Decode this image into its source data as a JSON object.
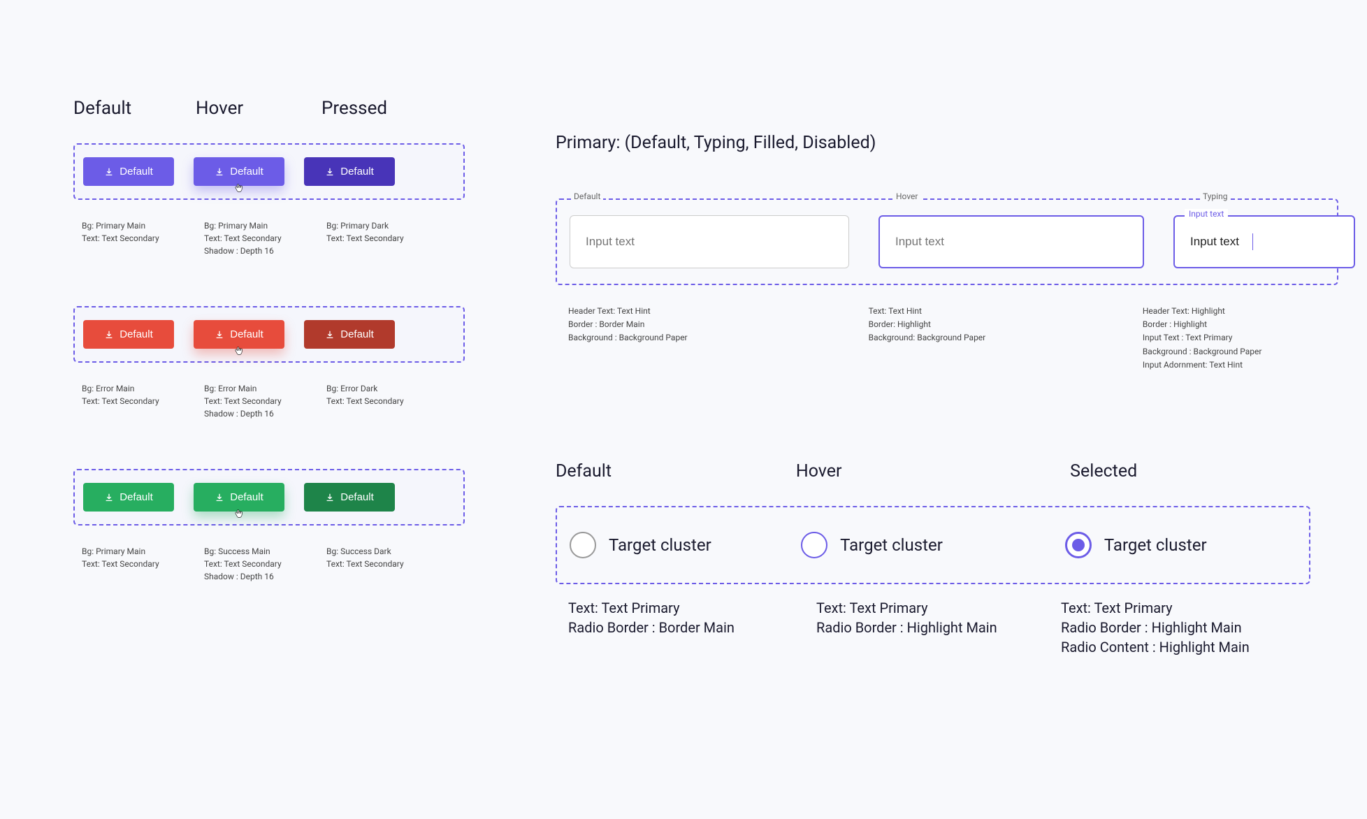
{
  "button_states": {
    "default": "Default",
    "hover": "Hover",
    "pressed": "Pressed"
  },
  "button_label": "Default",
  "button_specs": {
    "primary": {
      "default": "Bg: Primary Main\nText: Text Secondary",
      "hover": "Bg: Primary Main\nText: Text Secondary\nShadow : Depth 16",
      "pressed": "Bg: Primary Dark\nText: Text Secondary"
    },
    "error": {
      "default": "Bg: Error Main\nText: Text Secondary",
      "hover": "Bg: Error Main\nText: Text Secondary\nShadow : Depth 16",
      "pressed": "Bg: Error Dark\nText: Text Secondary"
    },
    "success": {
      "default": "Bg: Primary Main\nText: Text Secondary",
      "hover": "Bg: Success Main\nText: Text Secondary\nShadow : Depth 16",
      "pressed": "Bg: Success Dark\nText: Text Secondary"
    }
  },
  "input_section_title": "Primary: (Default, Typing, Filled, Disabled)",
  "input_states": {
    "default": "Default",
    "hover": "Hover",
    "typing": "Typing"
  },
  "input_placeholder": "Input text",
  "input_value_typing": "Input text",
  "input_floating_label": "Input text",
  "input_specs": {
    "default": "Header Text: Text Hint\nBorder : Border  Main\nBackground : Background Paper",
    "hover": "Text: Text Hint\nBorder:  Highlight\nBackground: Background Paper",
    "typing": "Header Text: Highlight\nBorder : Highlight\nInput Text : Text Primary\nBackground : Background Paper\nInput Adornment: Text Hint"
  },
  "radio_states": {
    "default": "Default",
    "hover": "Hover",
    "selected": "Selected"
  },
  "radio_label": "Target cluster",
  "radio_specs": {
    "default": "Text: Text Primary\nRadio Border : Border Main",
    "hover": "Text: Text Primary\nRadio Border : Highlight Main",
    "selected": "Text: Text Primary\nRadio Border : Highlight Main\nRadio Content : Highlight Main"
  }
}
